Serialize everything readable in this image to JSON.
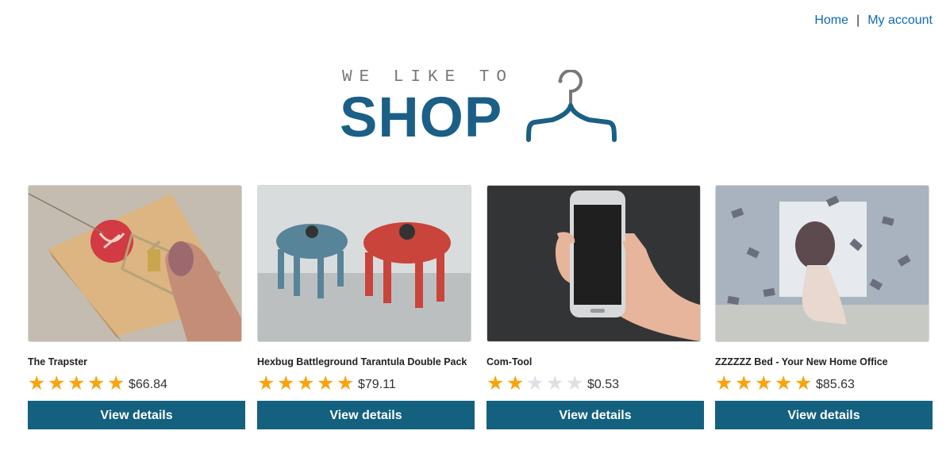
{
  "nav": {
    "home": "Home",
    "separator": "|",
    "account": "My account"
  },
  "logo": {
    "small_text": "WE LIKE TO",
    "big_text": "SHOP"
  },
  "colors": {
    "brand": "#1b5f86",
    "button": "#14607f",
    "star_on": "#f9a40d",
    "star_off": "#dde1e5",
    "link": "#0f6ab4"
  },
  "products": [
    {
      "title": "The Trapster",
      "rating": 5,
      "price": "$66.84",
      "button": "View details"
    },
    {
      "title": "Hexbug Battleground Tarantula Double Pack",
      "rating": 5,
      "price": "$79.11",
      "button": "View details"
    },
    {
      "title": "Com-Tool",
      "rating": 2,
      "price": "$0.53",
      "button": "View details"
    },
    {
      "title": "ZZZZZZ Bed - Your New Home Office",
      "rating": 5,
      "price": "$85.63",
      "button": "View details"
    }
  ]
}
